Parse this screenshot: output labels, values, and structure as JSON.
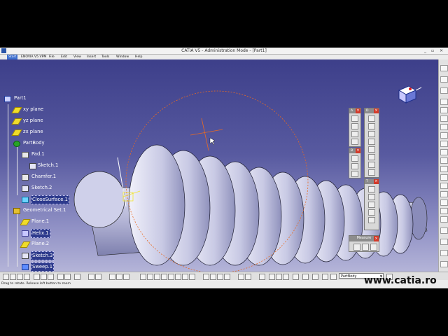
{
  "window": {
    "title": "CATIA V5 - Administration Mode - [Part1]",
    "controls": [
      "_",
      "▫",
      "×"
    ]
  },
  "menu": {
    "items": [
      "Start",
      "ENOVIA V5 VPM",
      "File",
      "Edit",
      "View",
      "Insert",
      "Tools",
      "Window",
      "Help"
    ]
  },
  "tree": {
    "root": "Part1",
    "nodes": [
      {
        "label": "xy plane",
        "icon": "plane-icon"
      },
      {
        "label": "yz plane",
        "icon": "plane-icon"
      },
      {
        "label": "zx plane",
        "icon": "plane-icon"
      },
      {
        "label": "PartBody",
        "icon": "partbody-icon"
      },
      {
        "label": "Pad.1",
        "icon": "pad-icon"
      },
      {
        "label": "Sketch.1",
        "icon": "sketch-icon"
      },
      {
        "label": "Chamfer.1",
        "icon": "chamfer-icon"
      },
      {
        "label": "Sketch.2",
        "icon": "sketch-icon"
      },
      {
        "label": "CloseSurface.1",
        "icon": "close-surface-icon"
      },
      {
        "label": "Geometrical Set.1",
        "icon": "geometrical-set-icon"
      },
      {
        "label": "Plane.1",
        "icon": "plane-icon"
      },
      {
        "label": "Helix.1",
        "icon": "helix-icon"
      },
      {
        "label": "Plane.2",
        "icon": "plane-icon"
      },
      {
        "label": "Sketch.3",
        "icon": "sketch-icon"
      },
      {
        "label": "Sweep.1",
        "icon": "sweep-icon"
      }
    ]
  },
  "palettes": {
    "a": "A",
    "d": "D",
    "b": "B",
    "t": "T",
    "measure": "Measure"
  },
  "toolbar": {
    "current_body": "PartBody"
  },
  "status": {
    "message": "Drag to rotate. Release left button to zoom"
  },
  "watermark": "www.catia.ro",
  "colors": {
    "viewport_top": "#3d3f8a",
    "viewport_bottom": "#b4b4d8",
    "tree_text": "#ffffff",
    "measure_close": "#d23a2a",
    "highlight": "#e96a22"
  }
}
